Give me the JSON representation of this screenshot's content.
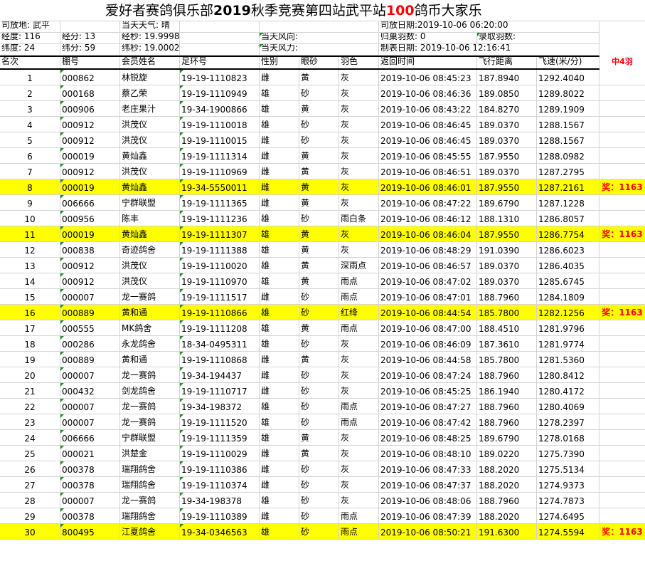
{
  "title": {
    "part1": "爱好者赛鸽俱乐部",
    "year": "2019",
    "part2": "秋季竞赛第四站武平站",
    "amount": "100",
    "part3": "鸽币大家乐"
  },
  "info": {
    "release_place": "司放地: 武平",
    "weather": "当天天气: 晴",
    "release_date": "司放日期:2019-10-06 06:20:00",
    "longitude": "经度: 116",
    "lon_min": "经分: 13",
    "lon_sec": "经秒: 19.9998",
    "wind_dir": "当天风向:",
    "returned": "归巢羽数: 0",
    "recorded": "录取羽数:",
    "latitude": "纬度:  24",
    "lat_min": "纬分: 59",
    "lat_sec": "纬秒: 19.0002",
    "wind_force": "当天风力:",
    "made_date": "制表日期: 2019-10-06 12:16:41"
  },
  "headers": [
    "名次",
    "棚号",
    "会员姓名",
    "足环号",
    "性别",
    "眼砂",
    "羽色",
    "返回时间",
    "飞行距离",
    "飞速(米/分)"
  ],
  "extra_header": "中4羽",
  "rows": [
    {
      "rank": "1",
      "loft": "000862",
      "name": "林锐旋",
      "ring": "19-19-1110823",
      "sex": "雌",
      "eye": "黄",
      "color": "灰",
      "time": "2019-10-06 08:45:23",
      "dist": "187.8940",
      "speed": "1292.4040",
      "award": ""
    },
    {
      "rank": "2",
      "loft": "000168",
      "name": "蔡乙荣",
      "ring": "19-19-1110949",
      "sex": "雄",
      "eye": "砂",
      "color": "灰",
      "time": "2019-10-06 08:46:36",
      "dist": "189.0850",
      "speed": "1289.8022",
      "award": ""
    },
    {
      "rank": "3",
      "loft": "000906",
      "name": "老庄果汁",
      "ring": "19-34-1900866",
      "sex": "雄",
      "eye": "黄",
      "color": "灰",
      "time": "2019-10-06 08:43:22",
      "dist": "184.8270",
      "speed": "1289.1909",
      "award": ""
    },
    {
      "rank": "4",
      "loft": "000912",
      "name": "洪茂仪",
      "ring": "19-19-1110018",
      "sex": "雄",
      "eye": "砂",
      "color": "灰",
      "time": "2019-10-06 08:46:45",
      "dist": "189.0370",
      "speed": "1288.1567",
      "award": ""
    },
    {
      "rank": "5",
      "loft": "000912",
      "name": "洪茂仪",
      "ring": "19-19-1110015",
      "sex": "雌",
      "eye": "砂",
      "color": "灰",
      "time": "2019-10-06 08:46:45",
      "dist": "189.0370",
      "speed": "1288.1567",
      "award": ""
    },
    {
      "rank": "6",
      "loft": "000019",
      "name": "黄灿鑫",
      "ring": "19-19-1111314",
      "sex": "雌",
      "eye": "黄",
      "color": "灰",
      "time": "2019-10-06 08:45:55",
      "dist": "187.9550",
      "speed": "1288.0982",
      "award": ""
    },
    {
      "rank": "7",
      "loft": "000912",
      "name": "洪茂仪",
      "ring": "19-19-1110969",
      "sex": "雌",
      "eye": "黄",
      "color": "灰",
      "time": "2019-10-06 08:46:51",
      "dist": "189.0370",
      "speed": "1287.2795",
      "award": ""
    },
    {
      "rank": "8",
      "loft": "000019",
      "name": "黄灿鑫",
      "ring": "19-34-5550011",
      "sex": "雌",
      "eye": "黄",
      "color": "灰",
      "time": "2019-10-06 08:46:01",
      "dist": "187.9550",
      "speed": "1287.2161",
      "award": "奖：1163"
    },
    {
      "rank": "9",
      "loft": "006666",
      "name": "宁群联盟",
      "ring": "19-19-1111365",
      "sex": "雌",
      "eye": "黄",
      "color": "灰",
      "time": "2019-10-06 08:47:22",
      "dist": "189.6790",
      "speed": "1287.1228",
      "award": ""
    },
    {
      "rank": "10",
      "loft": "000956",
      "name": "陈丰",
      "ring": "19-19-1111236",
      "sex": "雄",
      "eye": "砂",
      "color": "雨白条",
      "time": "2019-10-06 08:46:12",
      "dist": "188.1310",
      "speed": "1286.8057",
      "award": ""
    },
    {
      "rank": "11",
      "loft": "000019",
      "name": "黄灿鑫",
      "ring": "19-19-1111307",
      "sex": "雄",
      "eye": "黄",
      "color": "灰",
      "time": "2019-10-06 08:46:04",
      "dist": "187.9550",
      "speed": "1286.7754",
      "award": "奖：1163"
    },
    {
      "rank": "12",
      "loft": "000838",
      "name": "奇迹鸽舍",
      "ring": "19-19-1111388",
      "sex": "雄",
      "eye": "黄",
      "color": "灰",
      "time": "2019-10-06 08:48:29",
      "dist": "191.0390",
      "speed": "1286.6023",
      "award": ""
    },
    {
      "rank": "13",
      "loft": "000912",
      "name": "洪茂仪",
      "ring": "19-19-1110020",
      "sex": "雄",
      "eye": "黄",
      "color": "深雨点",
      "time": "2019-10-06 08:46:57",
      "dist": "189.0370",
      "speed": "1286.4035",
      "award": ""
    },
    {
      "rank": "14",
      "loft": "000912",
      "name": "洪茂仪",
      "ring": "19-19-1110970",
      "sex": "雄",
      "eye": "黄",
      "color": "雨点",
      "time": "2019-10-06 08:47:02",
      "dist": "189.0370",
      "speed": "1285.6745",
      "award": ""
    },
    {
      "rank": "15",
      "loft": "000007",
      "name": "龙一赛鸽",
      "ring": "19-19-1111517",
      "sex": "雌",
      "eye": "砂",
      "color": "雨点",
      "time": "2019-10-06 08:47:01",
      "dist": "188.7960",
      "speed": "1284.1809",
      "award": ""
    },
    {
      "rank": "16",
      "loft": "000889",
      "name": "黄和通",
      "ring": "19-19-1110866",
      "sex": "雄",
      "eye": "砂",
      "color": "红绛",
      "time": "2019-10-06 08:44:54",
      "dist": "185.7800",
      "speed": "1282.1256",
      "award": "奖：1163"
    },
    {
      "rank": "17",
      "loft": "000555",
      "name": "MK鸽舍",
      "ring": "19-19-1111208",
      "sex": "雄",
      "eye": "黄",
      "color": "雨点",
      "time": "2019-10-06 08:47:00",
      "dist": "188.4510",
      "speed": "1281.9796",
      "award": ""
    },
    {
      "rank": "18",
      "loft": "000286",
      "name": "永龙鸽舍",
      "ring": "18-34-0495311",
      "sex": "雄",
      "eye": "砂",
      "color": "灰",
      "time": "2019-10-06 08:46:09",
      "dist": "187.3610",
      "speed": "1281.9774",
      "award": ""
    },
    {
      "rank": "19",
      "loft": "000889",
      "name": "黄和通",
      "ring": "19-19-1110868",
      "sex": "雌",
      "eye": "黄",
      "color": "灰",
      "time": "2019-10-06 08:44:58",
      "dist": "185.7800",
      "speed": "1281.5360",
      "award": ""
    },
    {
      "rank": "20",
      "loft": "000007",
      "name": "龙一赛鸽",
      "ring": "19-34-194437",
      "sex": "雌",
      "eye": "砂",
      "color": "灰",
      "time": "2019-10-06 08:47:24",
      "dist": "188.7960",
      "speed": "1280.8412",
      "award": ""
    },
    {
      "rank": "21",
      "loft": "000432",
      "name": "剑龙鸽舍",
      "ring": "19-19-1110717",
      "sex": "雌",
      "eye": "砂",
      "color": "灰",
      "time": "2019-10-06 08:45:25",
      "dist": "186.1940",
      "speed": "1280.4172",
      "award": ""
    },
    {
      "rank": "22",
      "loft": "000007",
      "name": "龙一赛鸽",
      "ring": "19-34-198372",
      "sex": "雄",
      "eye": "砂",
      "color": "雨点",
      "time": "2019-10-06 08:47:27",
      "dist": "188.7960",
      "speed": "1280.4069",
      "award": ""
    },
    {
      "rank": "23",
      "loft": "000007",
      "name": "龙一赛鸽",
      "ring": "19-19-1111520",
      "sex": "雄",
      "eye": "砂",
      "color": "雨点",
      "time": "2019-10-06 08:47:42",
      "dist": "188.7960",
      "speed": "1278.2397",
      "award": ""
    },
    {
      "rank": "24",
      "loft": "006666",
      "name": "宁群联盟",
      "ring": "19-19-1111359",
      "sex": "雄",
      "eye": "黄",
      "color": "灰",
      "time": "2019-10-06 08:48:25",
      "dist": "189.6790",
      "speed": "1278.0168",
      "award": ""
    },
    {
      "rank": "25",
      "loft": "000021",
      "name": "洪楚金",
      "ring": "19-19-1110029",
      "sex": "雌",
      "eye": "黄",
      "color": "灰",
      "time": "2019-10-06 08:48:10",
      "dist": "189.0220",
      "speed": "1275.7390",
      "award": ""
    },
    {
      "rank": "26",
      "loft": "000378",
      "name": "瑞翔鸽舍",
      "ring": "19-19-1110386",
      "sex": "雌",
      "eye": "砂",
      "color": "灰",
      "time": "2019-10-06 08:47:33",
      "dist": "188.2020",
      "speed": "1275.5134",
      "award": ""
    },
    {
      "rank": "27",
      "loft": "000378",
      "name": "瑞翔鸽舍",
      "ring": "19-19-1110374",
      "sex": "雌",
      "eye": "砂",
      "color": "灰",
      "time": "2019-10-06 08:47:37",
      "dist": "188.2020",
      "speed": "1274.9373",
      "award": ""
    },
    {
      "rank": "28",
      "loft": "000007",
      "name": "龙一赛鸽",
      "ring": "19-34-198378",
      "sex": "雄",
      "eye": "砂",
      "color": "灰",
      "time": "2019-10-06 08:48:06",
      "dist": "188.7960",
      "speed": "1274.7873",
      "award": ""
    },
    {
      "rank": "29",
      "loft": "000378",
      "name": "瑞翔鸽舍",
      "ring": "19-19-1110389",
      "sex": "雌",
      "eye": "砂",
      "color": "雨点",
      "time": "2019-10-06 08:47:39",
      "dist": "188.2020",
      "speed": "1274.6495",
      "award": ""
    },
    {
      "rank": "30",
      "loft": "800495",
      "name": "江夏鸽舍",
      "ring": "19-34-0346563",
      "sex": "雄",
      "eye": "砂",
      "color": "雨点",
      "time": "2019-10-06 08:50:21",
      "dist": "191.6300",
      "speed": "1274.5594",
      "award": "奖：1163"
    }
  ],
  "highlighted_ranks": [
    "8",
    "11",
    "16",
    "30"
  ],
  "colors": {
    "highlight": "#ffff00",
    "award_text": "#ff0000",
    "title_red": "#ff0000"
  }
}
